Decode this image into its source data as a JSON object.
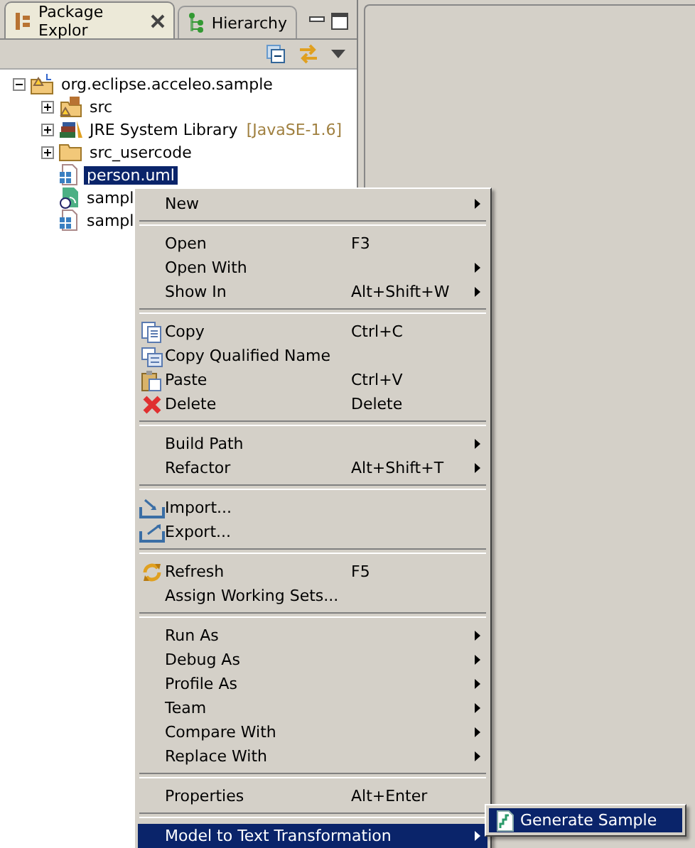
{
  "tabs": [
    {
      "label": "Package Explor",
      "selected": true
    },
    {
      "label": "Hierarchy",
      "selected": false
    }
  ],
  "tree": [
    {
      "label": "org.eclipse.acceleo.sample",
      "kind": "branch",
      "expanded": true,
      "selected": false,
      "children": [
        {
          "label": "src",
          "kind": "branch",
          "expanded": false,
          "selected": false
        },
        {
          "label": "JRE System Library",
          "decoration": "[JavaSE-1.6]",
          "kind": "branch",
          "expanded": false,
          "selected": false
        },
        {
          "label": "src_usercode",
          "kind": "branch",
          "expanded": false,
          "selected": false
        },
        {
          "label": "person.uml",
          "kind": "leaf",
          "selected": true
        },
        {
          "label": "sampl",
          "kind": "leaf",
          "selected": false
        },
        {
          "label": "sampl",
          "kind": "leaf",
          "selected": false
        }
      ]
    }
  ],
  "context_menu": [
    {
      "kind": "item",
      "label": "New",
      "has_submenu": true,
      "selected": false
    },
    {
      "kind": "separator"
    },
    {
      "kind": "item",
      "label": "Open",
      "shortcut": "F3",
      "has_submenu": false,
      "selected": false
    },
    {
      "kind": "item",
      "label": "Open With",
      "has_submenu": true,
      "selected": false
    },
    {
      "kind": "item",
      "label": "Show In",
      "shortcut": "Alt+Shift+W",
      "has_submenu": true,
      "selected": false
    },
    {
      "kind": "separator"
    },
    {
      "kind": "item",
      "label": "Copy",
      "shortcut": "Ctrl+C",
      "has_submenu": false,
      "selected": false
    },
    {
      "kind": "item",
      "label": "Copy Qualified Name",
      "has_submenu": false,
      "selected": false
    },
    {
      "kind": "item",
      "label": "Paste",
      "shortcut": "Ctrl+V",
      "has_submenu": false,
      "selected": false
    },
    {
      "kind": "item",
      "label": "Delete",
      "shortcut": "Delete",
      "has_submenu": false,
      "selected": false
    },
    {
      "kind": "separator"
    },
    {
      "kind": "item",
      "label": "Build Path",
      "has_submenu": true,
      "selected": false
    },
    {
      "kind": "item",
      "label": "Refactor",
      "shortcut": "Alt+Shift+T",
      "has_submenu": true,
      "selected": false
    },
    {
      "kind": "separator"
    },
    {
      "kind": "item",
      "label": "Import...",
      "has_submenu": false,
      "selected": false
    },
    {
      "kind": "item",
      "label": "Export...",
      "has_submenu": false,
      "selected": false
    },
    {
      "kind": "separator"
    },
    {
      "kind": "item",
      "label": "Refresh",
      "shortcut": "F5",
      "has_submenu": false,
      "selected": false
    },
    {
      "kind": "item",
      "label": "Assign Working Sets...",
      "has_submenu": false,
      "selected": false
    },
    {
      "kind": "separator"
    },
    {
      "kind": "item",
      "label": "Run As",
      "has_submenu": true,
      "selected": false
    },
    {
      "kind": "item",
      "label": "Debug As",
      "has_submenu": true,
      "selected": false
    },
    {
      "kind": "item",
      "label": "Profile As",
      "has_submenu": true,
      "selected": false
    },
    {
      "kind": "item",
      "label": "Team",
      "has_submenu": true,
      "selected": false
    },
    {
      "kind": "item",
      "label": "Compare With",
      "has_submenu": true,
      "selected": false
    },
    {
      "kind": "item",
      "label": "Replace With",
      "has_submenu": true,
      "selected": false
    },
    {
      "kind": "separator"
    },
    {
      "kind": "item",
      "label": "Properties",
      "shortcut": "Alt+Enter",
      "has_submenu": false,
      "selected": false
    },
    {
      "kind": "separator"
    },
    {
      "kind": "item",
      "label": "Model to Text Transformation",
      "has_submenu": true,
      "selected": true
    }
  ],
  "submenu": [
    {
      "label": "Generate Sample",
      "selected": true
    }
  ]
}
